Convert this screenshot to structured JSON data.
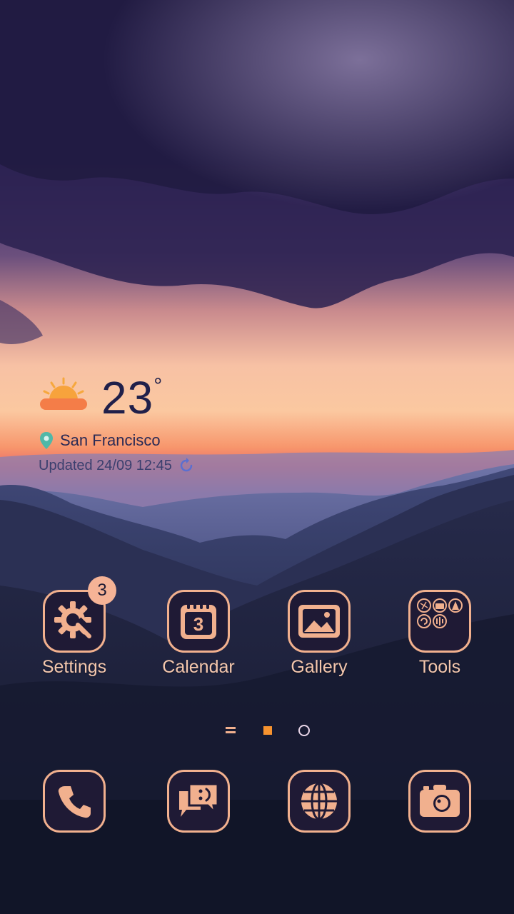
{
  "weather": {
    "temperature": "23",
    "degree_symbol": "°",
    "city": "San Francisco",
    "updated_text": "Updated 24/09 12:45",
    "icons": {
      "condition": "sun-behind-cloud-icon",
      "location": "location-pin-icon",
      "refresh": "refresh-icon"
    }
  },
  "apps": [
    {
      "label": "Settings",
      "icon": "gear-wrench-icon",
      "badge": "3"
    },
    {
      "label": "Calendar",
      "icon": "calendar-icon",
      "date": "3"
    },
    {
      "label": "Gallery",
      "icon": "image-icon"
    },
    {
      "label": "Tools",
      "icon": "folder-grid-icon"
    }
  ],
  "page_indicator": {
    "pages": 3,
    "current": 2
  },
  "dock": [
    {
      "icon": "phone-icon"
    },
    {
      "icon": "message-icon"
    },
    {
      "icon": "globe-icon"
    },
    {
      "icon": "camera-icon"
    }
  ],
  "colors": {
    "accent": "#f1b08e",
    "tile_bg": "#1f1a35",
    "label": "#f4c7ad",
    "sky_top": "#2b1f4f",
    "sunset": "#f77a5c"
  }
}
